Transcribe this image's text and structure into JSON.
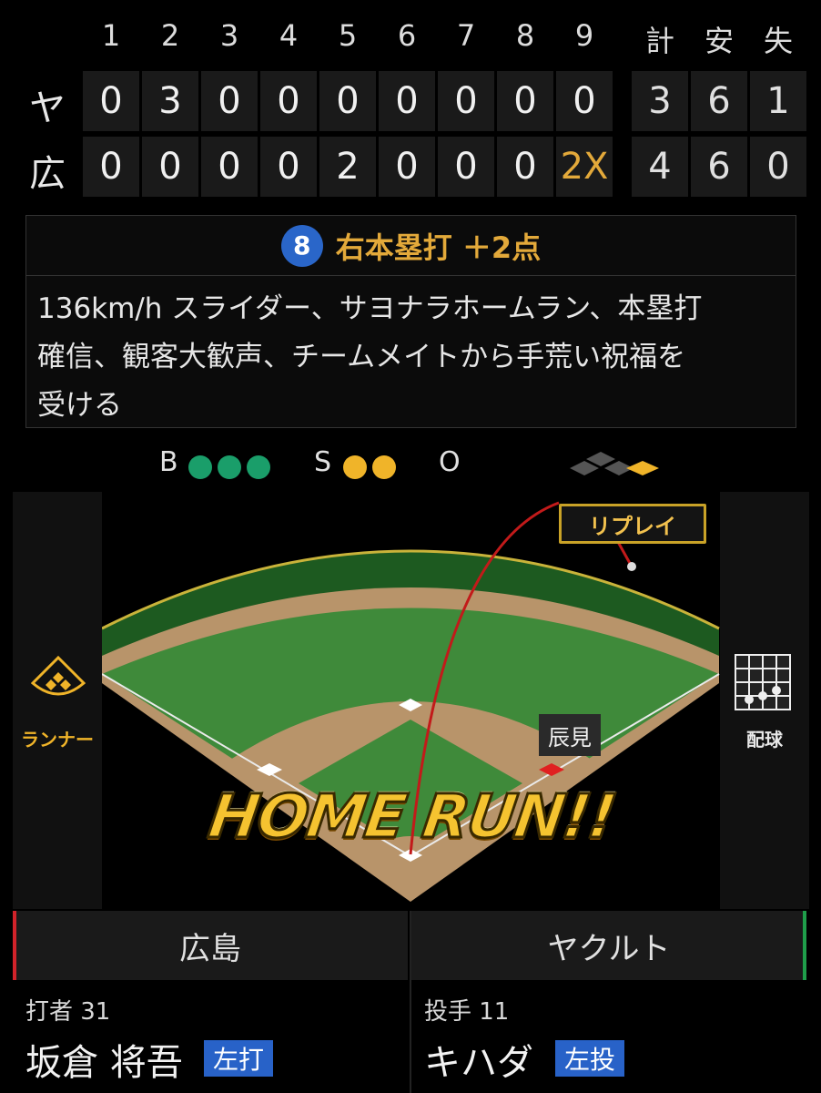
{
  "scoreboard": {
    "innings": [
      "1",
      "2",
      "3",
      "4",
      "5",
      "6",
      "7",
      "8",
      "9"
    ],
    "totals_headers": [
      "計",
      "安",
      "失"
    ],
    "teams": [
      {
        "abbr": "ヤ",
        "runs": [
          "0",
          "3",
          "0",
          "0",
          "0",
          "0",
          "0",
          "0",
          "0"
        ],
        "totals": [
          "3",
          "6",
          "1"
        ]
      },
      {
        "abbr": "広",
        "runs": [
          "0",
          "0",
          "0",
          "0",
          "2",
          "0",
          "0",
          "0",
          "2X"
        ],
        "totals": [
          "4",
          "6",
          "0"
        ]
      }
    ]
  },
  "play": {
    "badge": "8",
    "title": "右本塁打 ＋2点",
    "lines": [
      "136km/h スライダー、サヨナラホームラン、本塁打",
      "確信、観客大歓声、チームメイトから手荒い祝福を",
      "受ける"
    ]
  },
  "count": {
    "ball_label": "B",
    "balls": 3,
    "strike_label": "S",
    "strikes": 2,
    "out_label": "O",
    "outs": 0
  },
  "field": {
    "runner_label": "ランナー",
    "pitch_label": "配球",
    "replay_label": "リプレイ",
    "fielder_tag": "辰見",
    "home_run_text": "HOME RUN!!"
  },
  "tabs": {
    "home": "広島",
    "away": "ヤクルト",
    "home_color": "#d2232a",
    "away_color": "#1f9e4a"
  },
  "batter": {
    "role": "打者 31",
    "name": "坂倉 将吾",
    "hand": "左打"
  },
  "pitcher": {
    "role": "投手 11",
    "name": "キハダ",
    "hand": "左投"
  }
}
